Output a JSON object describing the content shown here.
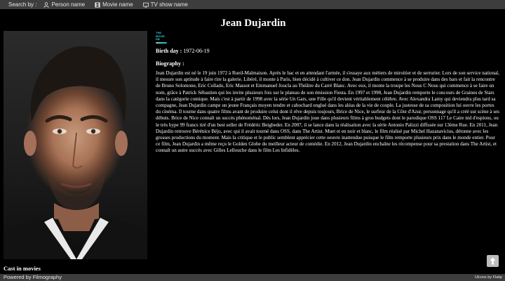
{
  "search_bar": {
    "label": "Search by :",
    "options": [
      {
        "label": "Person name",
        "icon": "person-icon"
      },
      {
        "label": "Movie name",
        "icon": "film-icon"
      },
      {
        "label": "TV show name",
        "icon": "tv-icon"
      }
    ]
  },
  "person": {
    "name": "Jean Dujardin",
    "birth_label": "Birth day :",
    "birth_value": "1972-06-19",
    "biography_label": "Biography :",
    "biography": "Jean Dujardin est né le 19 juin 1972 à Rueil-Malmaison. Après le bac et en attendant l'armée, il s'essaye aux métiers de miroitier et de serrurier. Lors de son service national, il mesure son aptitude à faire rire la galerie. Libéré, il monte à Paris, bien décidé à cultiver ce don. Jean Dujardin commence à se produire dans des bars et fait la rencontre de Bruno Solomone, Eric Collado, Eric Massot et Emmanuel Joucla au Théâtre du Carré Blanc. Avec eux, il monte la troupe les Nous C Nous qui commence à se faire un nom, grâce à Patrick Sébastien qui les invite plusieurs fois sur le plateau de son émission Fiesta. En 1997 et 1998, Jean Dujardin remporte le concours de Graines de Stars dans la catégorie comique. Mais c'est à partir de 1998 avec la série Un Gars, une Fille qu'il devient véritablement célèbre. Avec Alexandra Lamy qui deviendra plus tard sa compagne, Jean Dujardin campe un jeune Français moyen tendre et cabochard englué dans les aléas de la vie de couple. La justesse de sa composition lui ouvre les portes du cinéma. Il tourne dans quatre films avant de produire celui dont il rêve depuis toujours, Brice de Nice, le surfeur de la Côte d'Azur, personnage qu'il a créé sur scène à ses débuts. Brice de Nice connaît un succès phénoménal. Dès lors, Jean Dujardin joue dans plusieurs films à gros budgets dont le parodique OSS 117 Le Caire nid d'espions, ou le très hype 99 francs tiré d'un best seller de Frédéric Beigbeder. En 2007, il se lance dans la réalisation avec la série Antonio Palizzi diffusée sur 13ème Rue. En 2011, Jean Dujardin retrouve Bérénice Béjo, avec qui il avait tourné dans OSS, dans The Artist. Muet et en noir et blanc, le film réalisé par Michel Hazanavicius, détonne avec les grosses productions du moment. Mais la critique et le public semblent apprécier cette oeuvre inattendue puisque le film remporte plusieurs prix dans le monde entier. Pour ce film, Jean Dujardin a même reçu le Golden Globe du meilleur acteur de comédie. En 2012, Jean Dujardin enchaîne les récompense pour sa prestation dans The Artist, et connaît un autre succès avec Gilles Lellouche dans le film Les Infidèles."
  },
  "tmdb_logo_text": [
    "THE",
    "MOVIE",
    "DB"
  ],
  "cast_heading": "Cast in movies",
  "footer": {
    "left": "Powered by Filmography",
    "right": "Ulcons by Flatip"
  },
  "scroll_top_icon": "arrow-up-icon"
}
